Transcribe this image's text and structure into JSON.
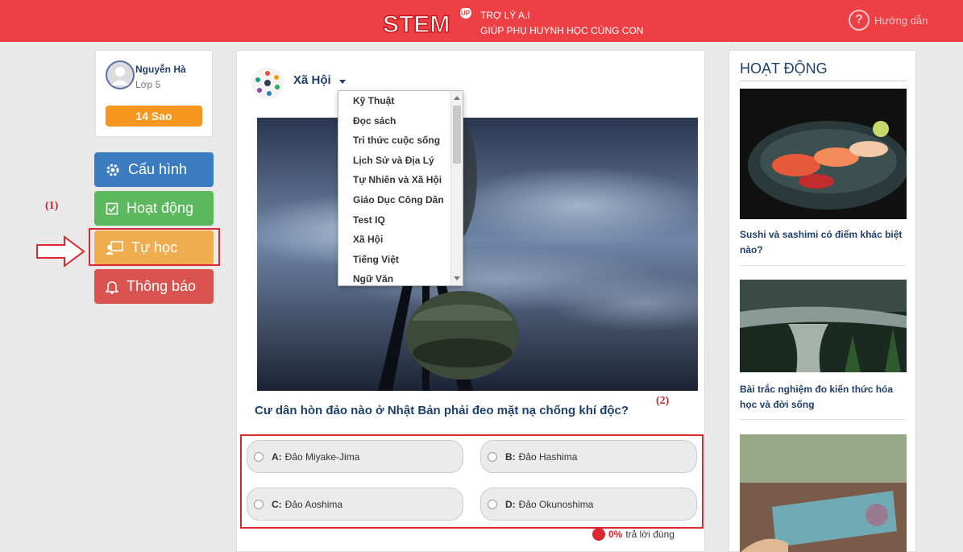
{
  "header": {
    "logo_text": "STEM",
    "logo_badge": "UP",
    "tagline_line1": "TRỢ LÝ A.I",
    "tagline_line2": "GIÚP PHỤ HUYNH HỌC CÙNG CON",
    "help_label": "Hướng dẫn",
    "help_icon": "question-circle-icon",
    "brand_color": "#ee3f45"
  },
  "profile": {
    "name": "Nguyễn Hà",
    "class": "Lớp 5",
    "stars_label": "14 Sao"
  },
  "menu": {
    "config": "Cấu hình",
    "activity": "Hoạt động",
    "self_study": "Tự học",
    "notify": "Thông báo"
  },
  "annotations": {
    "a1": "(1)",
    "a2": "(2)"
  },
  "subject": {
    "selected": "Xã Hội",
    "options": [
      "Kỹ Thuật",
      "Đọc sách",
      "Tri thức cuộc sống",
      "Lịch Sử và Địa Lý",
      "Tự Nhiên và Xã Hội",
      "Giáo Dục Công Dân",
      "Test IQ",
      "Xã Hội",
      "Tiếng Việt",
      "Ngữ Văn"
    ]
  },
  "quiz": {
    "question": "Cư dân hòn đảo nào ở Nhật Bản phải đeo mặt nạ chống khí độc?",
    "answers": [
      {
        "letter": "A:",
        "text": "Đảo Miyake-Jima"
      },
      {
        "letter": "B:",
        "text": "Đảo Hashima"
      },
      {
        "letter": "C:",
        "text": "Đảo Aoshima"
      },
      {
        "letter": "D:",
        "text": "Đảo Okunoshima"
      }
    ],
    "stat_value": "0%",
    "stat_text": "trả lời đúng"
  },
  "activities": {
    "title": "HOẠT ĐỘNG",
    "items": [
      {
        "title": "Sushi và sashimi có điểm khác biệt nào?"
      },
      {
        "title": "Bài trắc nghiệm đo kiến thức hóa học và đời sống"
      }
    ]
  }
}
